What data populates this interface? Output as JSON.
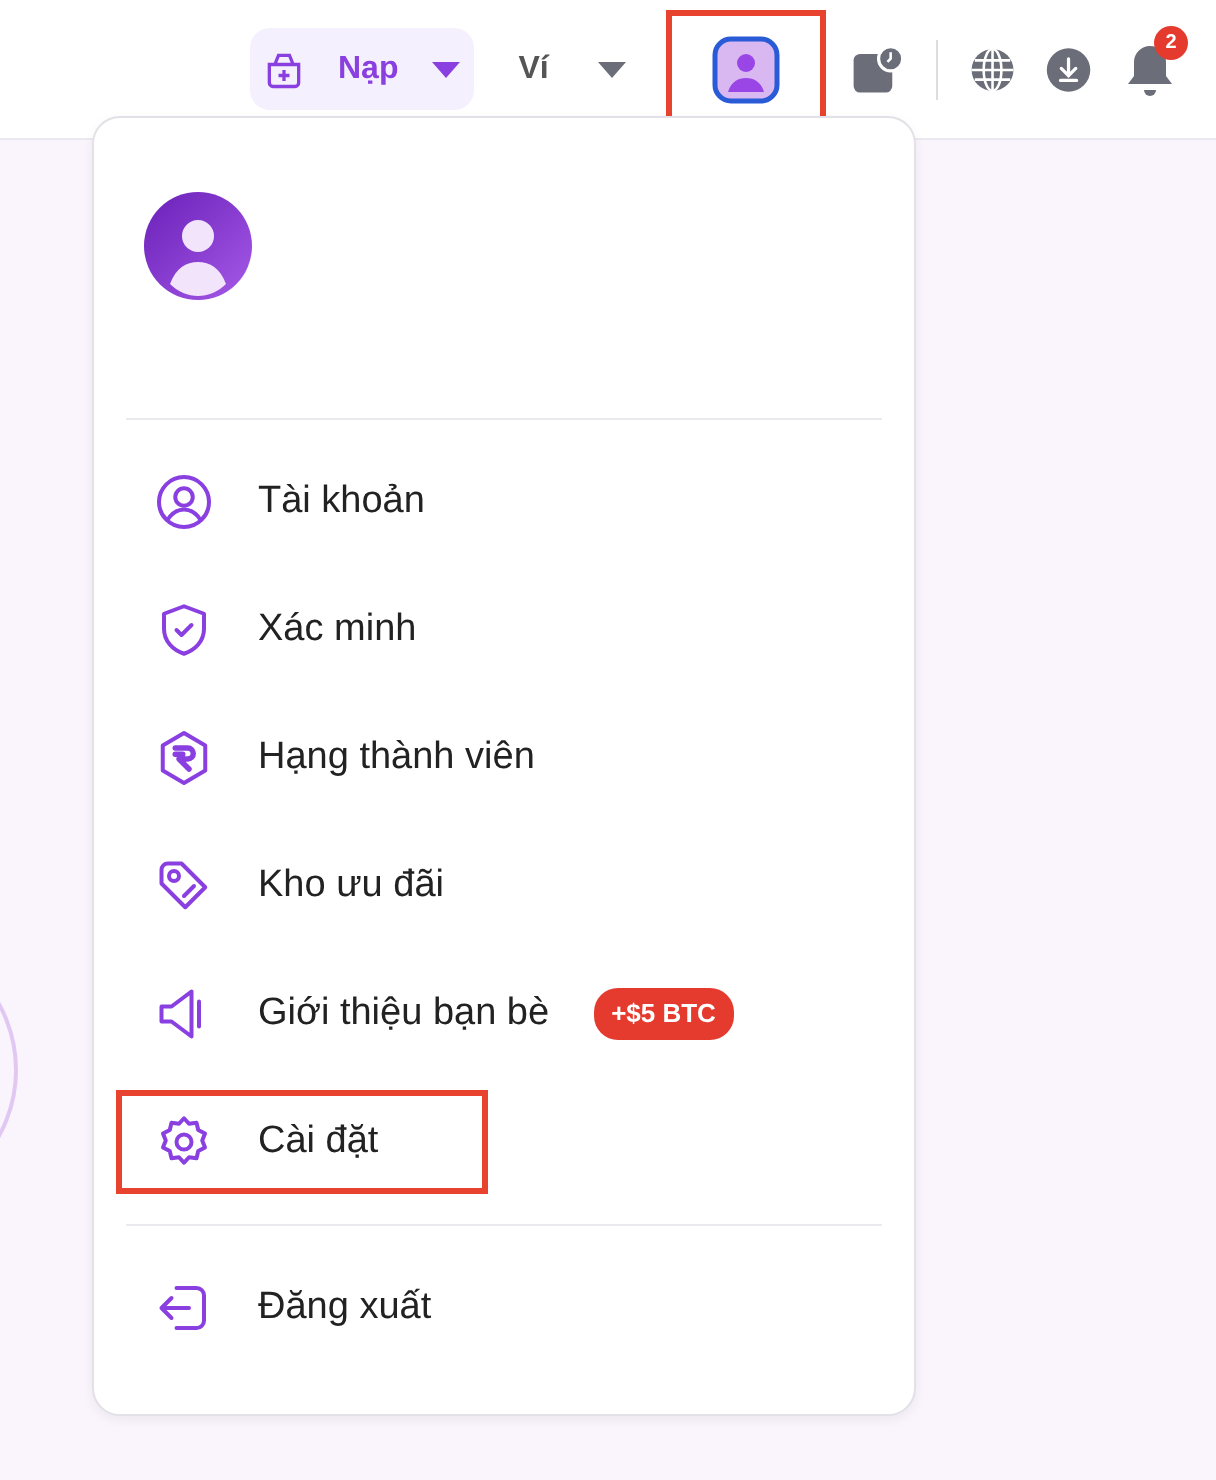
{
  "header": {
    "deposit": {
      "label": "Nạp"
    },
    "wallet": {
      "label": "Ví"
    },
    "profile_button": {
      "highlighted": true
    },
    "notifications": {
      "count": "2"
    }
  },
  "menu": {
    "items": [
      {
        "label": "Tài khoản",
        "highlighted": false
      },
      {
        "label": "Xác minh",
        "highlighted": false
      },
      {
        "label": "Hạng thành viên",
        "highlighted": false
      },
      {
        "label": "Kho ưu đãi",
        "highlighted": false
      },
      {
        "label": "Giới thiệu bạn bè",
        "highlighted": false,
        "badge": "+$5 BTC"
      },
      {
        "label": "Cài đặt",
        "highlighted": true
      }
    ],
    "footer_items": [
      {
        "label": "Đăng xuất",
        "highlighted": false
      }
    ]
  }
}
